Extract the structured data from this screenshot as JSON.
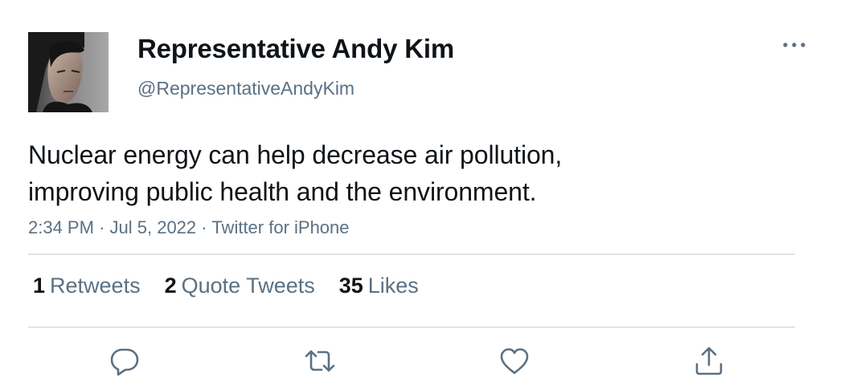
{
  "user": {
    "display_name": "Representative Andy Kim",
    "handle": "@RepresentativeAndyKim"
  },
  "tweet": {
    "text_line1": "Nuclear energy can help decrease air pollution,",
    "text_line2": "improving public health and the environment.",
    "time": "2:34 PM",
    "separator": "·",
    "date": "Jul 5, 2022",
    "source": "Twitter for iPhone"
  },
  "stats": {
    "retweets_count": "1",
    "retweets_label": "Retweets",
    "quotes_count": "2",
    "quotes_label": "Quote Tweets",
    "likes_count": "35",
    "likes_label": "Likes"
  },
  "icons": {
    "more": "more-horizontal-icon",
    "reply": "reply-bubble-icon",
    "retweet": "retweet-arrows-icon",
    "like": "heart-icon",
    "share": "share-upload-icon"
  },
  "colors": {
    "text_primary": "#0f1419",
    "text_secondary": "#5b7083",
    "divider": "#dfe4e8"
  }
}
